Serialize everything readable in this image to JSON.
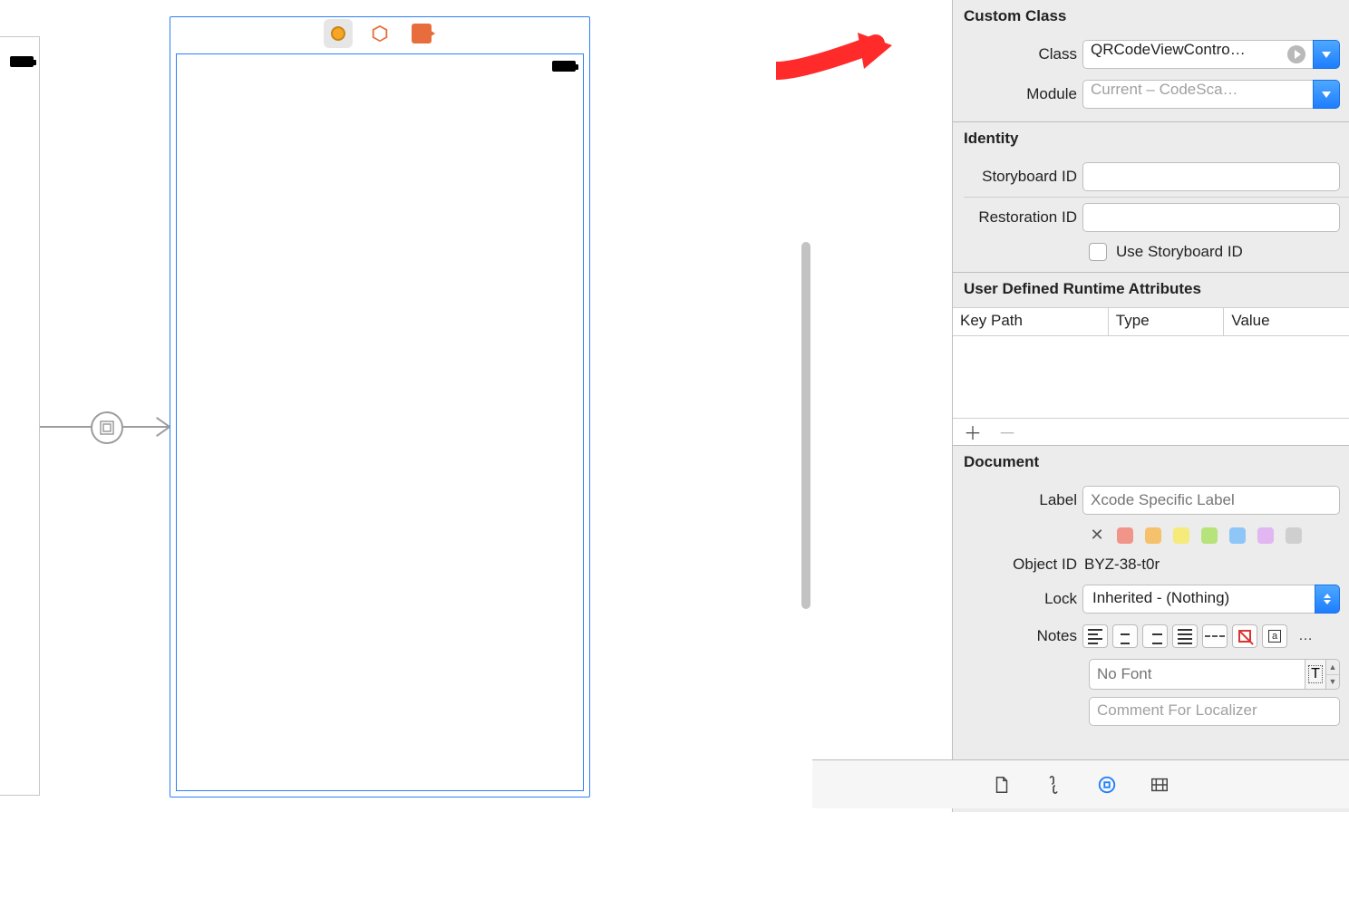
{
  "custom_class": {
    "title": "Custom Class",
    "class_label": "Class",
    "class_value": "QRCodeViewContro…",
    "module_label": "Module",
    "module_placeholder": "Current – CodeSca…"
  },
  "identity": {
    "title": "Identity",
    "storyboard_id_label": "Storyboard ID",
    "storyboard_id_value": "",
    "restoration_id_label": "Restoration ID",
    "restoration_id_value": "",
    "use_sb_label": "Use Storyboard ID"
  },
  "runtime": {
    "title": "User Defined Runtime Attributes",
    "col_keypath": "Key Path",
    "col_type": "Type",
    "col_value": "Value",
    "add": "＋",
    "remove": "－"
  },
  "document": {
    "title": "Document",
    "label_label": "Label",
    "label_placeholder": "Xcode Specific Label",
    "object_id_label": "Object ID",
    "object_id_value": "BYZ-38-t0r",
    "lock_label": "Lock",
    "lock_value": "Inherited - (Nothing)",
    "notes_label": "Notes",
    "font_placeholder": "No Font",
    "comment_placeholder": "Comment For Localizer",
    "more": "…",
    "colors": {
      "clear": "✕",
      "red": "#f1948a",
      "orange": "#f5c16c",
      "yellow": "#f5ea7a",
      "green": "#b6e37a",
      "blue": "#8ec6f7",
      "purple": "#e1b6f2",
      "gray": "#cfcfcf"
    }
  }
}
